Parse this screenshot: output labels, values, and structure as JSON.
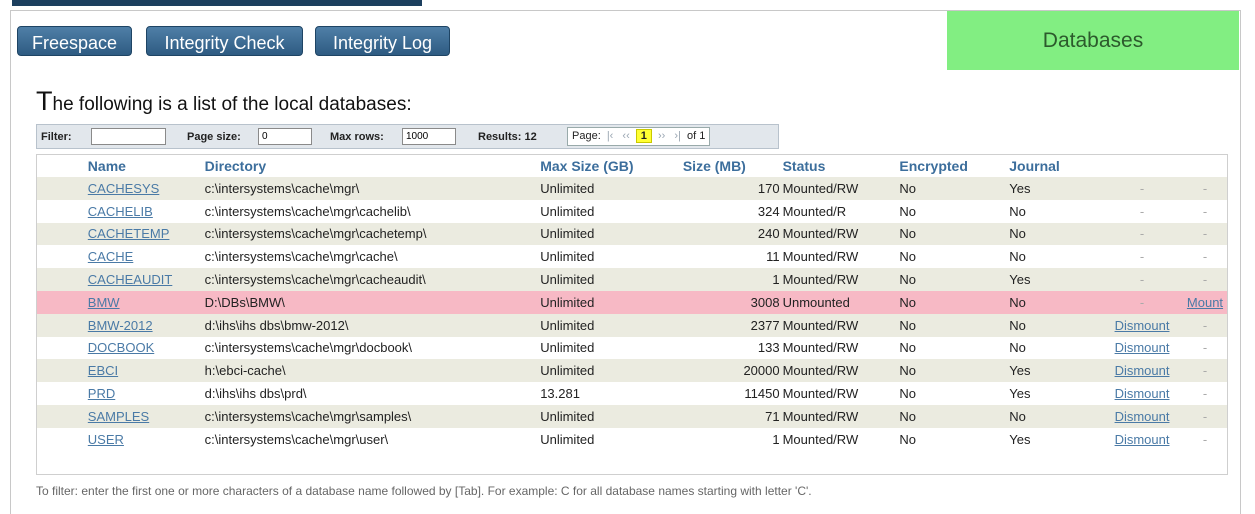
{
  "nav": {
    "freespace": "Freespace",
    "integrity_check": "Integrity Check",
    "integrity_log": "Integrity Log",
    "banner": "Databases"
  },
  "heading": {
    "first_letter": "T",
    "rest": "he following is a list of the local databases:"
  },
  "filter_bar": {
    "filter_label": "Filter:",
    "filter_value": "",
    "page_size_label": "Page size:",
    "page_size_value": "0",
    "max_rows_label": "Max rows:",
    "max_rows_value": "1000",
    "results_label": "Results: 12",
    "page_label": "Page:",
    "current_page": "1",
    "of_pages": "of 1"
  },
  "table": {
    "columns": [
      "Name",
      "Directory",
      "Max Size (GB)",
      "Size (MB)",
      "Status",
      "Encrypted",
      "Journal"
    ],
    "rows": [
      {
        "name": "CACHESYS",
        "directory": "c:\\intersystems\\cache\\mgr\\",
        "max_size": "Unlimited",
        "size": "170",
        "status": "Mounted/RW",
        "encrypted": "No",
        "journal": "Yes",
        "action1": "-",
        "action2": "-"
      },
      {
        "name": "CACHELIB",
        "directory": "c:\\intersystems\\cache\\mgr\\cachelib\\",
        "max_size": "Unlimited",
        "size": "324",
        "status": "Mounted/R",
        "encrypted": "No",
        "journal": "No",
        "action1": "-",
        "action2": "-"
      },
      {
        "name": "CACHETEMP",
        "directory": "c:\\intersystems\\cache\\mgr\\cachetemp\\",
        "max_size": "Unlimited",
        "size": "240",
        "status": "Mounted/RW",
        "encrypted": "No",
        "journal": "No",
        "action1": "-",
        "action2": "-"
      },
      {
        "name": "CACHE",
        "directory": "c:\\intersystems\\cache\\mgr\\cache\\",
        "max_size": "Unlimited",
        "size": "11",
        "status": "Mounted/RW",
        "encrypted": "No",
        "journal": "No",
        "action1": "-",
        "action2": "-"
      },
      {
        "name": "CACHEAUDIT",
        "directory": "c:\\intersystems\\cache\\mgr\\cacheaudit\\",
        "max_size": "Unlimited",
        "size": "1",
        "status": "Mounted/RW",
        "encrypted": "No",
        "journal": "Yes",
        "action1": "-",
        "action2": "-"
      },
      {
        "name": "BMW",
        "directory": "D:\\DBs\\BMW\\",
        "max_size": "Unlimited",
        "size": "3008",
        "status": "Unmounted",
        "encrypted": "No",
        "journal": "No",
        "action1": "-",
        "action2": "Mount"
      },
      {
        "name": "BMW-2012",
        "directory": "d:\\ihs\\ihs dbs\\bmw-2012\\",
        "max_size": "Unlimited",
        "size": "2377",
        "status": "Mounted/RW",
        "encrypted": "No",
        "journal": "No",
        "action1": "Dismount",
        "action2": "-"
      },
      {
        "name": "DOCBOOK",
        "directory": "c:\\intersystems\\cache\\mgr\\docbook\\",
        "max_size": "Unlimited",
        "size": "133",
        "status": "Mounted/RW",
        "encrypted": "No",
        "journal": "No",
        "action1": "Dismount",
        "action2": "-"
      },
      {
        "name": "EBCI",
        "directory": "h:\\ebci-cache\\",
        "max_size": "Unlimited",
        "size": "20000",
        "status": "Mounted/RW",
        "encrypted": "No",
        "journal": "Yes",
        "action1": "Dismount",
        "action2": "-"
      },
      {
        "name": "PRD",
        "directory": "d:\\ihs\\ihs dbs\\prd\\",
        "max_size": "13.281",
        "size": "11450",
        "status": "Mounted/RW",
        "encrypted": "No",
        "journal": "Yes",
        "action1": "Dismount",
        "action2": "-"
      },
      {
        "name": "SAMPLES",
        "directory": "c:\\intersystems\\cache\\mgr\\samples\\",
        "max_size": "Unlimited",
        "size": "71",
        "status": "Mounted/RW",
        "encrypted": "No",
        "journal": "No",
        "action1": "Dismount",
        "action2": "-"
      },
      {
        "name": "USER",
        "directory": "c:\\intersystems\\cache\\mgr\\user\\",
        "max_size": "Unlimited",
        "size": "1",
        "status": "Mounted/RW",
        "encrypted": "No",
        "journal": "Yes",
        "action1": "Dismount",
        "action2": "-"
      }
    ],
    "highlight_row": "BMW",
    "highlight_color": "#f7b9c5"
  },
  "footer_note": "To filter: enter the first one or more characters of a database name followed by [Tab]. For example: C for all database names starting with letter 'C'.",
  "colors": {
    "nav_button": "#2e5b82",
    "banner": "#82ee82",
    "header_text": "#3c6e9c",
    "odd_row": "#ebebe0"
  }
}
